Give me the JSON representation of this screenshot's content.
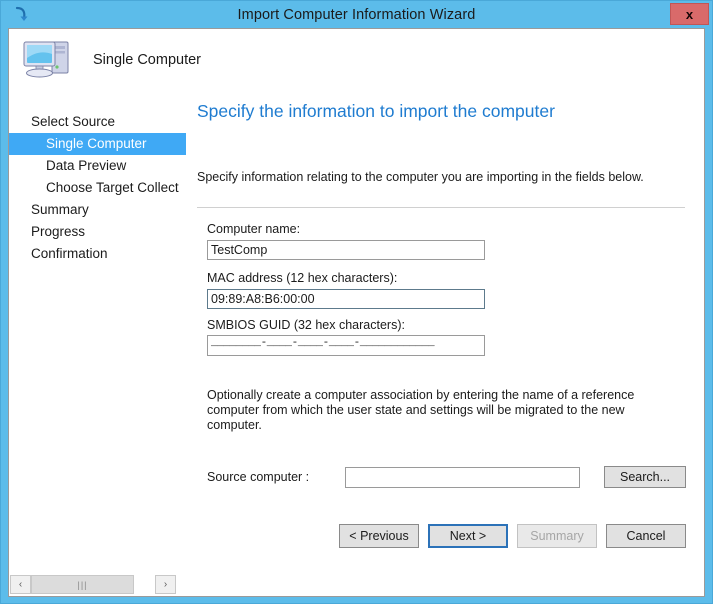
{
  "window": {
    "title": "Import Computer Information Wizard",
    "close_label": "x",
    "titlebar_icon": "import-arrow-icon",
    "frame_color": "#5cbcea"
  },
  "header": {
    "icon": "computer-icon",
    "label": "Single Computer"
  },
  "sidebar": {
    "items": [
      {
        "label": "Select Source",
        "level": 0,
        "selected": false
      },
      {
        "label": "Single Computer",
        "level": 1,
        "selected": true
      },
      {
        "label": "Data Preview",
        "level": 1,
        "selected": false
      },
      {
        "label": "Choose Target Collect",
        "level": 1,
        "selected": false
      },
      {
        "label": "Summary",
        "level": 0,
        "selected": false
      },
      {
        "label": "Progress",
        "level": 0,
        "selected": false
      },
      {
        "label": "Confirmation",
        "level": 0,
        "selected": false
      }
    ],
    "selected_color": "#3fa9f5"
  },
  "main": {
    "page_title": "Specify the information to import the computer",
    "page_title_color": "#1f7cd0",
    "intro_text": "Specify information relating to the computer you are importing in the fields below.",
    "fields": {
      "computer_name": {
        "label": "Computer name:",
        "value": "TestComp",
        "placeholder": ""
      },
      "mac_address": {
        "label": "MAC address (12 hex characters):",
        "value": "09:89:A8:B6:00:00",
        "placeholder": ""
      },
      "smbios_guid": {
        "label": "SMBIOS GUID (32 hex characters):",
        "value": "",
        "mask": "________-____-____-____-____________"
      }
    },
    "optional_text": "Optionally create a computer association by entering the name of a reference computer from which the user state and settings will be migrated to the new computer.",
    "source_computer": {
      "label": "Source computer :",
      "value": "",
      "placeholder": ""
    },
    "search_button": "Search..."
  },
  "wizard_buttons": {
    "previous": "< Previous",
    "next": "Next >",
    "summary": "Summary",
    "cancel": "Cancel"
  },
  "scrollbar": {
    "left_arrow": "‹",
    "right_arrow": "›",
    "thumb_grip": "|||"
  }
}
